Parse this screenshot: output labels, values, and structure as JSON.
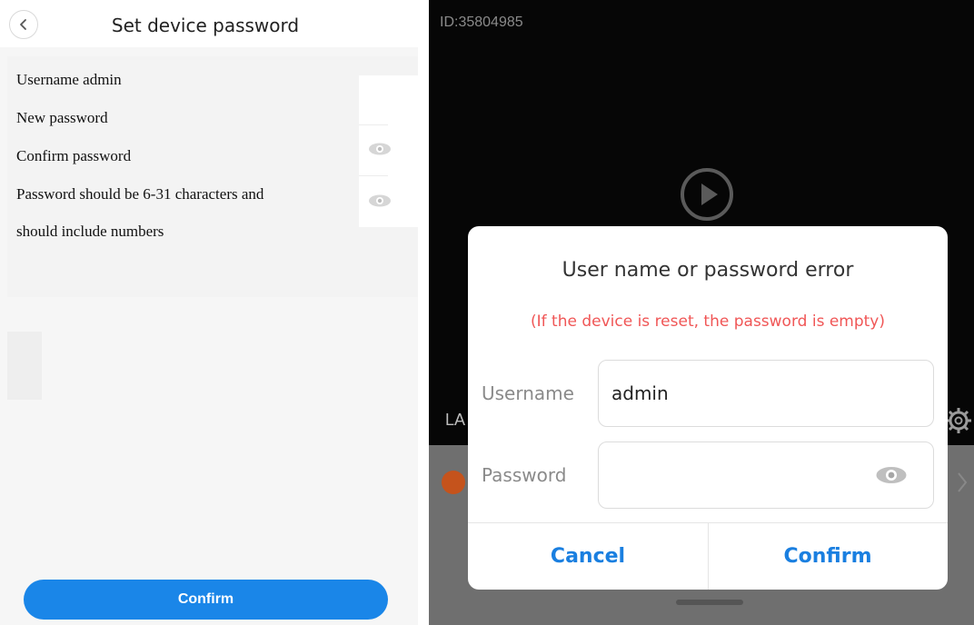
{
  "left_screen": {
    "title": "Set device password",
    "username_line": "Username admin",
    "new_password_label": "New password",
    "confirm_password_label": "Confirm password",
    "hint_line1": "Password should be 6-31 characters and",
    "hint_line2": "should include numbers",
    "confirm_button": "Confirm",
    "icons": [
      "chevron-left-icon",
      "eye-icon"
    ]
  },
  "right_screen": {
    "device_id": "ID:35804985",
    "partial_label": "LA",
    "icons": [
      "play-icon",
      "gear-icon",
      "chevron-right-icon",
      "eye-icon"
    ],
    "dialog": {
      "title": "User name or password error",
      "subtitle": "(If the device is reset, the password is empty)",
      "username_label": "Username",
      "username_value": "admin",
      "password_label": "Password",
      "password_value": "",
      "cancel_button": "Cancel",
      "confirm_button": "Confirm"
    }
  },
  "colors": {
    "accent_blue": "#1a86e8",
    "dialog_button_blue": "#1a7fe0",
    "error_red": "#f05656",
    "dark_bg": "#060606"
  }
}
